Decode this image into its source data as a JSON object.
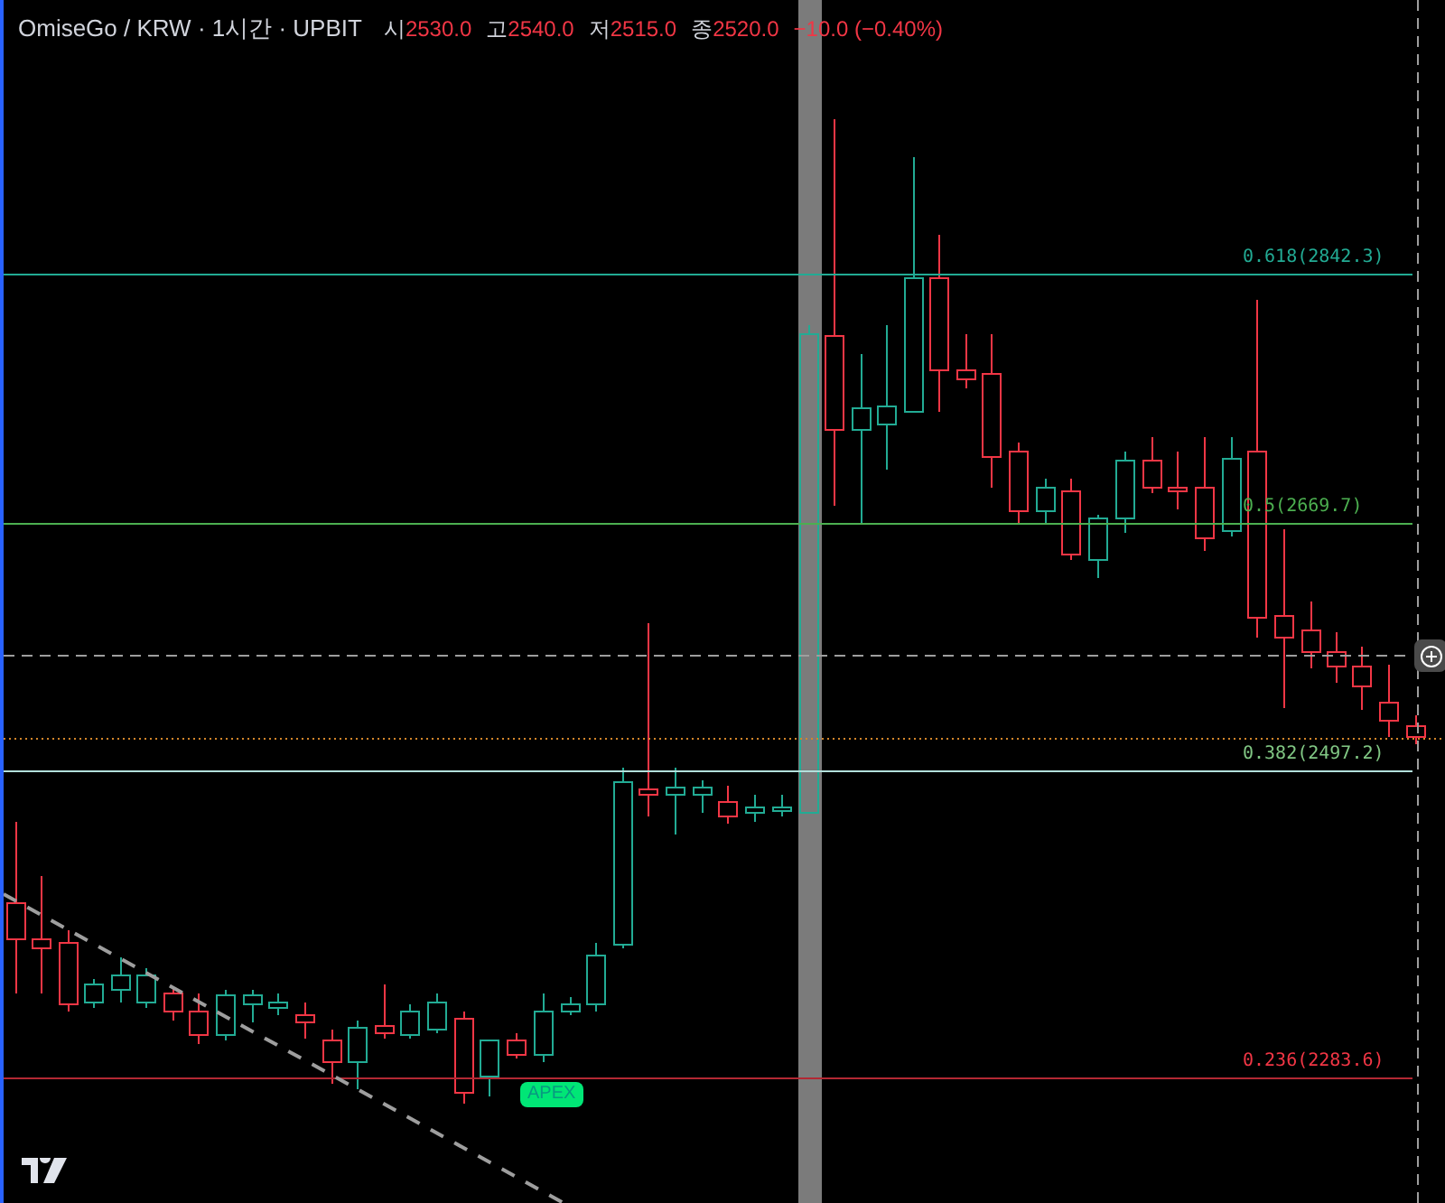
{
  "header": {
    "symbol": "OmiseGo / KRW · 1시간 · UPBIT",
    "ohlc": [
      {
        "label": "시",
        "value": "2530.0"
      },
      {
        "label": "고",
        "value": "2540.0"
      },
      {
        "label": "저",
        "value": "2515.0"
      },
      {
        "label": "종",
        "value": "2520.0"
      }
    ],
    "change": "−10.0 (−0.40%)"
  },
  "fib_levels": [
    {
      "label": "0.618(2842.3)",
      "color": "#22ab94"
    },
    {
      "label": "0.5(2669.7)",
      "color": "#4caf50"
    },
    {
      "label": "0.382(2497.2)",
      "color": "#81c784"
    },
    {
      "label": "0.236(2283.6)",
      "color": "#f23645"
    }
  ],
  "marker": {
    "label": "APEX"
  }
}
